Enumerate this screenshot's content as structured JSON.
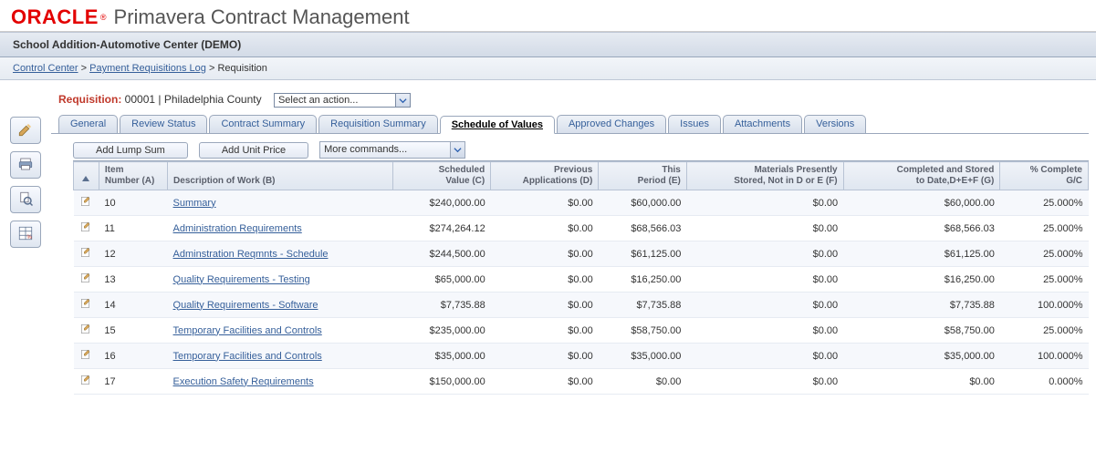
{
  "brand": {
    "logo": "ORACLE",
    "product": "Primavera Contract Management"
  },
  "project": "School Addition-Automotive Center (DEMO)",
  "breadcrumb": {
    "c1": "Control Center",
    "c2": "Payment Requisitions Log",
    "c3": "Requisition",
    "sep": ">"
  },
  "requisition": {
    "label": "Requisition:",
    "id": "00001",
    "location": "Philadelphia County",
    "action_placeholder": "Select an action..."
  },
  "tabs": {
    "t0": "General",
    "t1": "Review Status",
    "t2": "Contract Summary",
    "t3": "Requisition Summary",
    "t4": "Schedule of Values",
    "t5": "Approved Changes",
    "t6": "Issues",
    "t7": "Attachments",
    "t8": "Versions"
  },
  "toolbar": {
    "add_lump": "Add Lump Sum",
    "add_unit": "Add Unit Price",
    "more": "More commands..."
  },
  "columns": {
    "item": "Item\nNumber (A)",
    "desc": "Description of Work (B)",
    "sched": "Scheduled\nValue (C)",
    "prev": "Previous\nApplications (D)",
    "this": "This\nPeriod (E)",
    "mat": "Materials Presently\nStored, Not in D or E (F)",
    "comp": "Completed and Stored\nto Date,D+E+F (G)",
    "pct": "% Complete\nG/C"
  },
  "rows": [
    {
      "item": "10",
      "desc": "Summary",
      "c": "$240,000.00",
      "d": "$0.00",
      "e": "$60,000.00",
      "f": "$0.00",
      "g": "$60,000.00",
      "pct": "25.000%"
    },
    {
      "item": "11",
      "desc": "Administration Requirements",
      "c": "$274,264.12",
      "d": "$0.00",
      "e": "$68,566.03",
      "f": "$0.00",
      "g": "$68,566.03",
      "pct": "25.000%"
    },
    {
      "item": "12",
      "desc": "Adminstration Reqmnts - Schedule",
      "c": "$244,500.00",
      "d": "$0.00",
      "e": "$61,125.00",
      "f": "$0.00",
      "g": "$61,125.00",
      "pct": "25.000%"
    },
    {
      "item": "13",
      "desc": "Quality Requirements - Testing",
      "c": "$65,000.00",
      "d": "$0.00",
      "e": "$16,250.00",
      "f": "$0.00",
      "g": "$16,250.00",
      "pct": "25.000%"
    },
    {
      "item": "14",
      "desc": "Quality Requirements - Software",
      "c": "$7,735.88",
      "d": "$0.00",
      "e": "$7,735.88",
      "f": "$0.00",
      "g": "$7,735.88",
      "pct": "100.000%"
    },
    {
      "item": "15",
      "desc": "Temporary Facilities and Controls",
      "c": "$235,000.00",
      "d": "$0.00",
      "e": "$58,750.00",
      "f": "$0.00",
      "g": "$58,750.00",
      "pct": "25.000%"
    },
    {
      "item": "16",
      "desc": "Temporary Facilities and Controls",
      "c": "$35,000.00",
      "d": "$0.00",
      "e": "$35,000.00",
      "f": "$0.00",
      "g": "$35,000.00",
      "pct": "100.000%"
    },
    {
      "item": "17",
      "desc": "Execution Safety Requirements",
      "c": "$150,000.00",
      "d": "$0.00",
      "e": "$0.00",
      "f": "$0.00",
      "g": "$0.00",
      "pct": "0.000%"
    }
  ],
  "left_tools": {
    "edit": "edit-icon",
    "print": "print-icon",
    "preview": "preview-icon",
    "grid": "grid-percent-icon"
  }
}
